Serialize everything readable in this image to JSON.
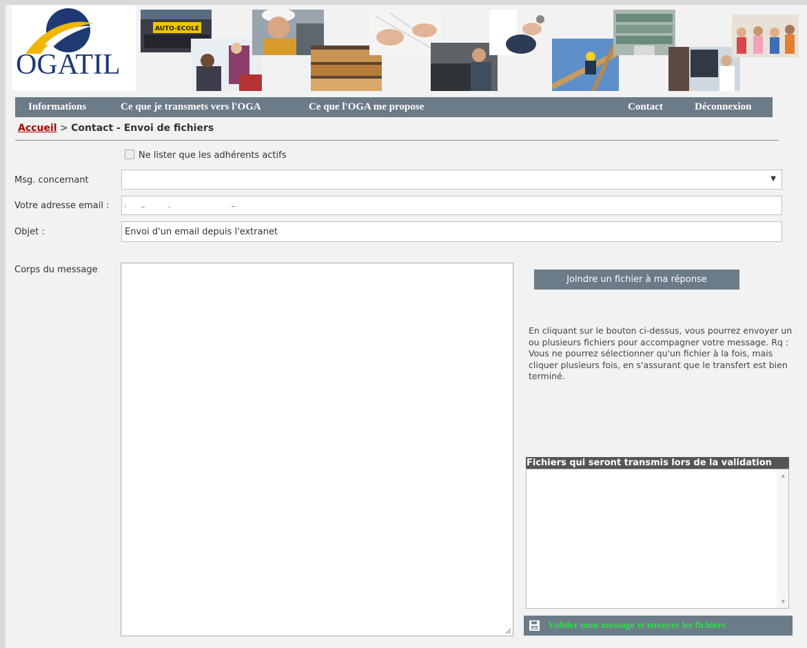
{
  "brand": {
    "logo_text": "OGATIL",
    "logo_color": "#1f3a73",
    "swoosh_color": "#f2b600"
  },
  "banner_photos": [
    {
      "name": "driving-school-photo",
      "sign_text": "AUTO-ECOLE"
    },
    {
      "name": "classroom-photo"
    },
    {
      "name": "electrician-photo"
    },
    {
      "name": "bakery-photo"
    },
    {
      "name": "architect-drawing-photo"
    },
    {
      "name": "mechanic-photo"
    },
    {
      "name": "doctor-photo"
    },
    {
      "name": "construction-worker-photo"
    },
    {
      "name": "pharmacy-photo"
    },
    {
      "name": "radiology-photo"
    },
    {
      "name": "children-photo"
    }
  ],
  "nav": {
    "items": [
      {
        "label": "Informations"
      },
      {
        "label": "Ce que je transmets vers l'OGA"
      },
      {
        "label": "Ce que l'OGA me propose"
      },
      {
        "label": "Contact"
      },
      {
        "label": "Déconnexion"
      }
    ]
  },
  "breadcrumb": {
    "home": "Accueil",
    "separator": ">",
    "current": "Contact - Envoi de fichiers"
  },
  "form": {
    "active_only_label": "Ne lister que les adhérents actifs",
    "active_only_checked": false,
    "msg_concerning": {
      "label": "Msg. concernant",
      "value": ""
    },
    "email": {
      "label": "Votre adresse email :",
      "value": ""
    },
    "subject": {
      "label": "Objet :",
      "value": "Envoi d'un email depuis l'extranet"
    },
    "body": {
      "label": "Corps du message",
      "value": ""
    }
  },
  "attach": {
    "button_label": "Joindre un fichier à ma réponse",
    "help_text": "En cliquant sur le bouton ci-dessus, vous pourrez envoyer un ou plusieurs fichiers pour accompagner votre message. Rq : Vous ne pourrez sélectionner qu'un fichier à la fois, mais cliquer plusieurs fois, en s'assurant que le transfert est bien terminé.",
    "files_header": "Fichiers qui seront transmis lors de la validation",
    "files": []
  },
  "submit": {
    "label": "Valider mon message et envoyer les fichiers",
    "icon": "save-icon",
    "label_color": "#2ee04a"
  },
  "colors": {
    "nav_bg": "#6b7b88",
    "breadcrumb_link": "#b00000",
    "page_bg": "#f2f2f2"
  }
}
